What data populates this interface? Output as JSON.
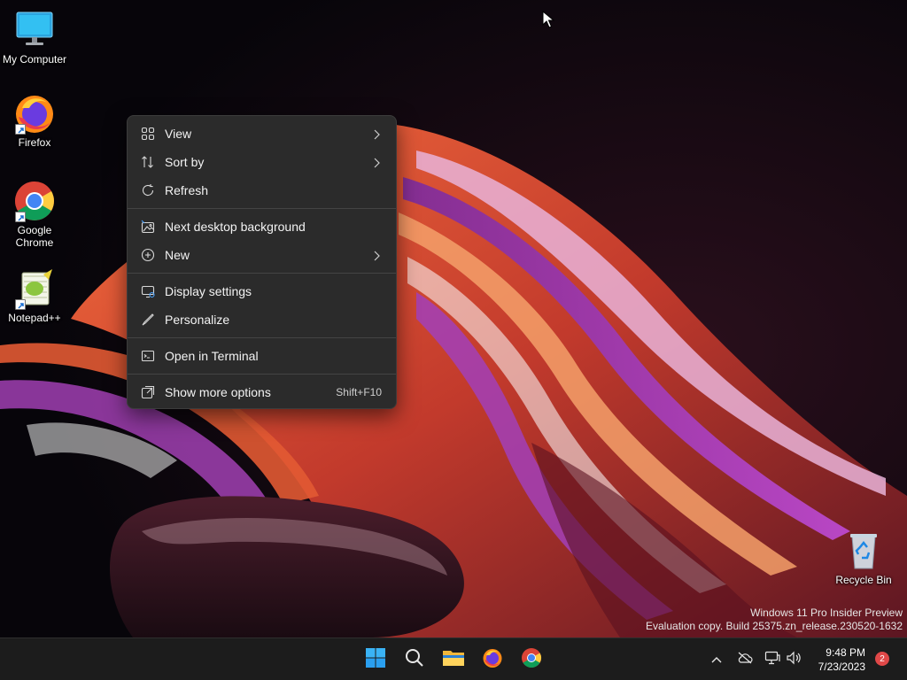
{
  "desktop": {
    "icons": [
      {
        "label": "My Computer",
        "icon": "monitor-icon"
      },
      {
        "label": "Firefox",
        "icon": "firefox-icon"
      },
      {
        "label": "Google Chrome",
        "icon": "chrome-icon"
      },
      {
        "label": "Notepad++",
        "icon": "notepadpp-icon"
      },
      {
        "label": "Recycle Bin",
        "icon": "recycle-bin-icon"
      }
    ]
  },
  "context_menu": {
    "items": [
      {
        "label": "View",
        "icon": "view-grid-icon",
        "submenu": true
      },
      {
        "label": "Sort by",
        "icon": "sort-icon",
        "submenu": true
      },
      {
        "label": "Refresh",
        "icon": "refresh-icon",
        "submenu": false
      },
      {
        "label": "Next desktop background",
        "icon": "next-background-icon",
        "submenu": false
      },
      {
        "label": "New",
        "icon": "new-plus-icon",
        "submenu": true
      },
      {
        "label": "Display settings",
        "icon": "display-settings-icon",
        "submenu": false
      },
      {
        "label": "Personalize",
        "icon": "personalize-pen-icon",
        "submenu": false
      },
      {
        "label": "Open in Terminal",
        "icon": "terminal-icon",
        "submenu": false
      },
      {
        "label": "Show more options",
        "icon": "show-more-icon",
        "submenu": false,
        "shortcut": "Shift+F10"
      }
    ]
  },
  "watermark": {
    "line1": "Windows 11 Pro Insider Preview",
    "line2": "Evaluation copy. Build 25375.zn_release.230520-1632"
  },
  "taskbar": {
    "pinned": [
      "start-icon",
      "search-icon",
      "file-explorer-icon",
      "firefox-icon",
      "chrome-icon"
    ],
    "tray": [
      "chevron-up-icon",
      "onedrive-offline-icon",
      "network-icon",
      "volume-icon"
    ],
    "time": "9:48 PM",
    "date": "7/23/2023",
    "notification_count": "2"
  },
  "colors": {
    "menu_bg": "#2b2b2b",
    "taskbar_bg": "#1c1c1c",
    "accent": "#0078d4"
  }
}
